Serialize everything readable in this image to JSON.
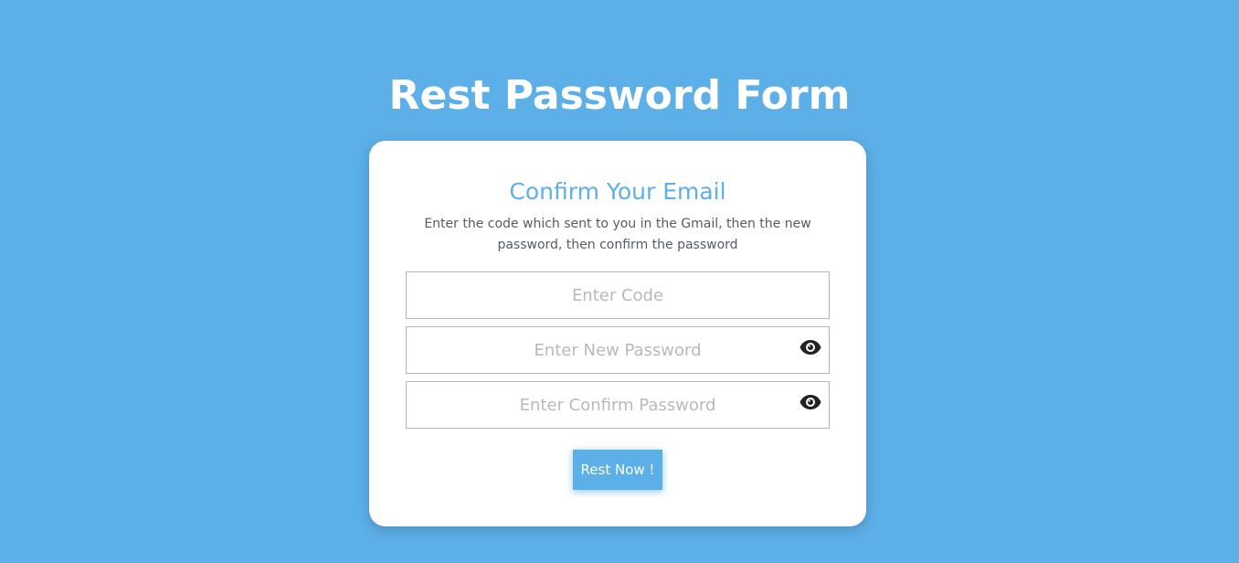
{
  "page": {
    "title": "Rest Password Form"
  },
  "card": {
    "title": "Confirm Your Email",
    "description": "Enter the code which sent to you in the Gmail, then the new password, then confirm the password"
  },
  "form": {
    "code_placeholder": "Enter Code",
    "new_password_placeholder": "Enter New Password",
    "confirm_password_placeholder": "Enter Confirm Password",
    "submit_label": "Rest Now !"
  },
  "icons": {
    "toggle_new_password": "eye-icon",
    "toggle_confirm_password": "eye-icon"
  },
  "colors": {
    "background": "#5dafe8",
    "accent": "#5dafe8",
    "card": "#ffffff",
    "text_muted": "#555b63"
  }
}
